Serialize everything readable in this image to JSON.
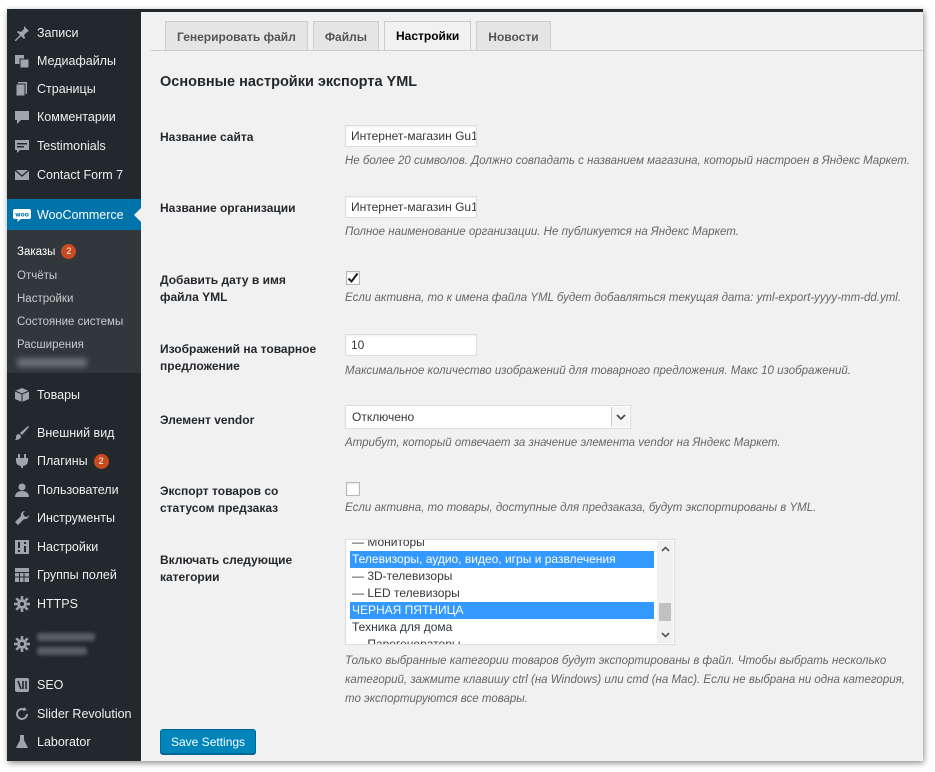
{
  "sidebar": {
    "items": [
      {
        "label": "Записи",
        "icon": "pin-icon"
      },
      {
        "label": "Медиафайлы",
        "icon": "media-icon"
      },
      {
        "label": "Страницы",
        "icon": "pages-icon"
      },
      {
        "label": "Комментарии",
        "icon": "comment-icon"
      },
      {
        "label": "Testimonials",
        "icon": "testimonials-icon"
      },
      {
        "label": "Contact Form 7",
        "icon": "mail-icon"
      },
      {
        "label": "WooCommerce",
        "icon": "woo-icon"
      },
      {
        "label": "Товары",
        "icon": "box-icon"
      },
      {
        "label": "Внешний вид",
        "icon": "brush-icon"
      },
      {
        "label": "Плагины",
        "icon": "plugin-icon",
        "badge": "2"
      },
      {
        "label": "Пользователи",
        "icon": "user-icon"
      },
      {
        "label": "Инструменты",
        "icon": "wrench-icon"
      },
      {
        "label": "Настройки",
        "icon": "settings-icon"
      },
      {
        "label": "Группы полей",
        "icon": "grid-icon"
      },
      {
        "label": "HTTPS",
        "icon": "gear-icon"
      },
      {
        "label": "SEO",
        "icon": "seo-icon"
      },
      {
        "label": "Slider Revolution",
        "icon": "refresh-icon"
      },
      {
        "label": "Laborator",
        "icon": "flask-icon"
      }
    ],
    "submenu": [
      {
        "label": "Заказы",
        "badge": "2"
      },
      {
        "label": "Отчёты"
      },
      {
        "label": "Настройки"
      },
      {
        "label": "Состояние системы"
      },
      {
        "label": "Расширения"
      }
    ]
  },
  "tabs": [
    {
      "label": "Генерировать файл",
      "active": false
    },
    {
      "label": "Файлы",
      "active": false
    },
    {
      "label": "Настройки",
      "active": true
    },
    {
      "label": "Новости",
      "active": false
    }
  ],
  "section_title": "Основные настройки экспорта YML",
  "fields": {
    "site_name": {
      "label": "Название сайта",
      "value": "Интернет-магазин Gu1",
      "desc": "Не более 20 символов. Должно совпадать с названием магазина, который настроен в Яндекс Маркет."
    },
    "org_name": {
      "label": "Название организации",
      "value": "Интернет-магазин Gu1",
      "desc": "Полное наименование организации. Не публикуется на Яндекс Маркет."
    },
    "add_date": {
      "label": "Добавить дату в имя файла YML",
      "checked": true,
      "desc": "Если активна, то к имена файла YML будет добавляться текущая дата: yml-export-yyyy-mm-dd.yml."
    },
    "images": {
      "label": "Изображений на товарное предложение",
      "value": "10",
      "desc": "Максимальное количество изображений для товарного предложения. Макс 10 изображений."
    },
    "vendor": {
      "label": "Элемент vendor",
      "value": "Отключено",
      "desc": "Атрибут, который отвечает за значение элемента vendor на Яндекс Маркет."
    },
    "preorder": {
      "label": "Экспорт товаров со статусом предзаказ",
      "checked": false,
      "desc": "Если активна, то товары, доступные для предзаказа, будут экспортированы в YML."
    },
    "categories": {
      "label": "Включать следующие категории",
      "options": [
        {
          "label": "— Мониторы",
          "selected": false
        },
        {
          "label": "Телевизоры, аудио, видео, игры и развлечения",
          "selected": true
        },
        {
          "label": "— 3D-телевизоры",
          "selected": false
        },
        {
          "label": "— LED телевизоры",
          "selected": false
        },
        {
          "label": "ЧЕРНАЯ ПЯТНИЦА",
          "selected": true
        },
        {
          "label": "Техника для дома",
          "selected": false
        },
        {
          "label": "— Парогенераторы",
          "selected": false
        }
      ],
      "desc": "Только выбранные категории товаров будут экспортированы в файл. Чтобы выбрать несколько категорий, зажмите клавишу ctrl (на Windows) или cmd (на Mac). Если не выбрана ни одна категория, то экспортируются все товары."
    }
  },
  "save_button": "Save Settings",
  "colors": {
    "sidebar_bg": "#23282d",
    "submenu_bg": "#32373c",
    "accent": "#0073aa",
    "badge": "#ca4a1f",
    "button": "#0085ba",
    "selection": "#3399ff"
  }
}
